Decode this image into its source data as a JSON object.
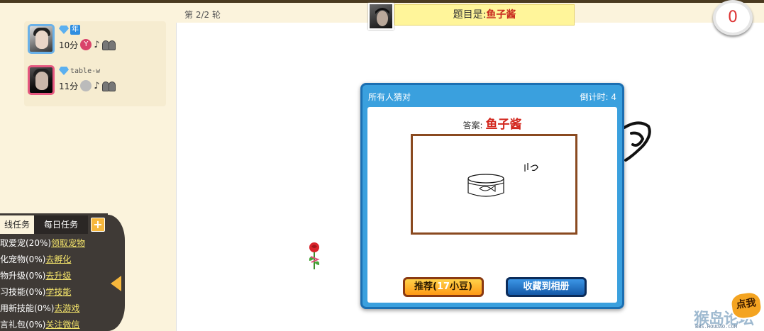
{
  "round": {
    "label": "第 2/2 轮"
  },
  "topic": {
    "prefix": "题目是:",
    "answer": "鱼子酱"
  },
  "timer": {
    "value": "0"
  },
  "players": [
    {
      "name": "",
      "badge": "年",
      "score": "10分",
      "gift": "Y"
    },
    {
      "name": "table-w",
      "badge": "",
      "score": "11分",
      "gift": ""
    }
  ],
  "tasks": {
    "tabs": [
      "线任务",
      "每日任务"
    ],
    "plus_label": "+",
    "items": [
      {
        "text": "取爱宠(20%)",
        "action": "领取宠物"
      },
      {
        "text": "化宠物(0%)",
        "action": "去孵化"
      },
      {
        "text": "物升级(0%)",
        "action": "去升级"
      },
      {
        "text": "习技能(0%)",
        "action": "学技能"
      },
      {
        "text": "用新技能(0%)",
        "action": "去游戏"
      },
      {
        "text": "言礼包(0%)",
        "action": "关注微信"
      }
    ]
  },
  "modal": {
    "title": "所有人猜对",
    "countdown": "倒计时: 4",
    "answer_label": "答案:",
    "answer_value": "鱼子酱",
    "drawing_text": "鱼子酱",
    "recommend_button": {
      "label": "推荐(",
      "qty": "17",
      "unit": "小豆)"
    },
    "save_button": "收藏到相册"
  },
  "logo": {
    "text": "猴岛论坛",
    "url": "BBS.HOUDAO.COM",
    "badge": "点我"
  },
  "colors": {
    "accent_blue": "#3aa0de",
    "topic_yellow": "#fff59a",
    "answer_red": "#d3281f",
    "sidebar_bg": "#fbf3dc"
  }
}
